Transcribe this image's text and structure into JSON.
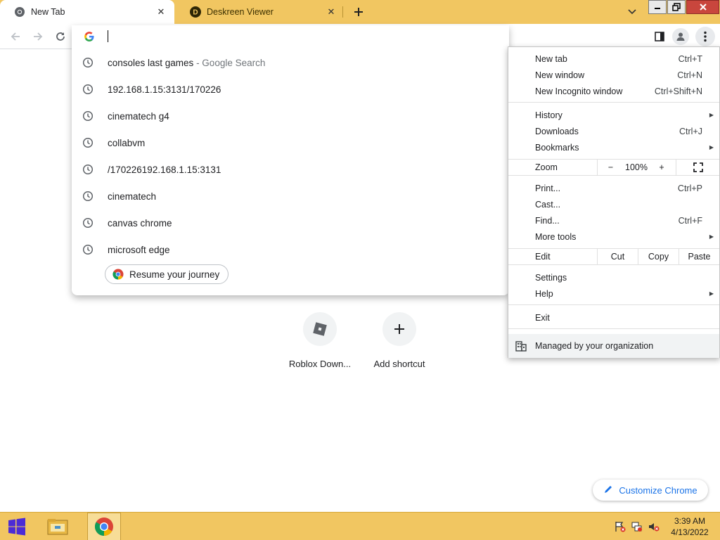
{
  "tabs": [
    {
      "title": "New Tab",
      "icon": "chrome-icon",
      "active": true
    },
    {
      "title": "Deskreen Viewer",
      "icon": "deskreen-icon",
      "active": false
    }
  ],
  "omnibox": {
    "value": "",
    "suggestions": [
      {
        "text": "consoles last games",
        "sub": " - Google Search"
      },
      {
        "text": "192.168.1.15:3131/170226",
        "sub": ""
      },
      {
        "text": "cinematech g4",
        "sub": ""
      },
      {
        "text": "collabvm",
        "sub": ""
      },
      {
        "text": "/170226192.168.1.15:3131",
        "sub": ""
      },
      {
        "text": "cinematech",
        "sub": ""
      },
      {
        "text": "canvas chrome",
        "sub": ""
      },
      {
        "text": "microsoft edge",
        "sub": ""
      }
    ],
    "resume_label": "Resume your journey"
  },
  "shortcuts": [
    {
      "label": "Roblox Down...",
      "icon": "roblox-icon"
    },
    {
      "label": "Add shortcut",
      "icon": "plus-icon"
    }
  ],
  "customize_label": "Customize Chrome",
  "menu": {
    "new_tab": {
      "label": "New tab",
      "shortcut": "Ctrl+T"
    },
    "new_window": {
      "label": "New window",
      "shortcut": "Ctrl+N"
    },
    "new_incognito": {
      "label": "New Incognito window",
      "shortcut": "Ctrl+Shift+N"
    },
    "history": {
      "label": "History"
    },
    "downloads": {
      "label": "Downloads",
      "shortcut": "Ctrl+J"
    },
    "bookmarks": {
      "label": "Bookmarks"
    },
    "zoom": {
      "label": "Zoom",
      "minus": "−",
      "value": "100%",
      "plus": "+"
    },
    "print": {
      "label": "Print...",
      "shortcut": "Ctrl+P"
    },
    "cast": {
      "label": "Cast..."
    },
    "find": {
      "label": "Find...",
      "shortcut": "Ctrl+F"
    },
    "more_tools": {
      "label": "More tools"
    },
    "edit": {
      "label": "Edit",
      "cut": "Cut",
      "copy": "Copy",
      "paste": "Paste"
    },
    "settings": {
      "label": "Settings"
    },
    "help": {
      "label": "Help"
    },
    "exit": {
      "label": "Exit"
    },
    "managed": {
      "label": "Managed by your organization"
    }
  },
  "taskbar": {
    "time": "3:39 AM",
    "date": "4/13/2022"
  },
  "colors": {
    "frame": "#f1c661",
    "accent": "#1a73e8"
  }
}
